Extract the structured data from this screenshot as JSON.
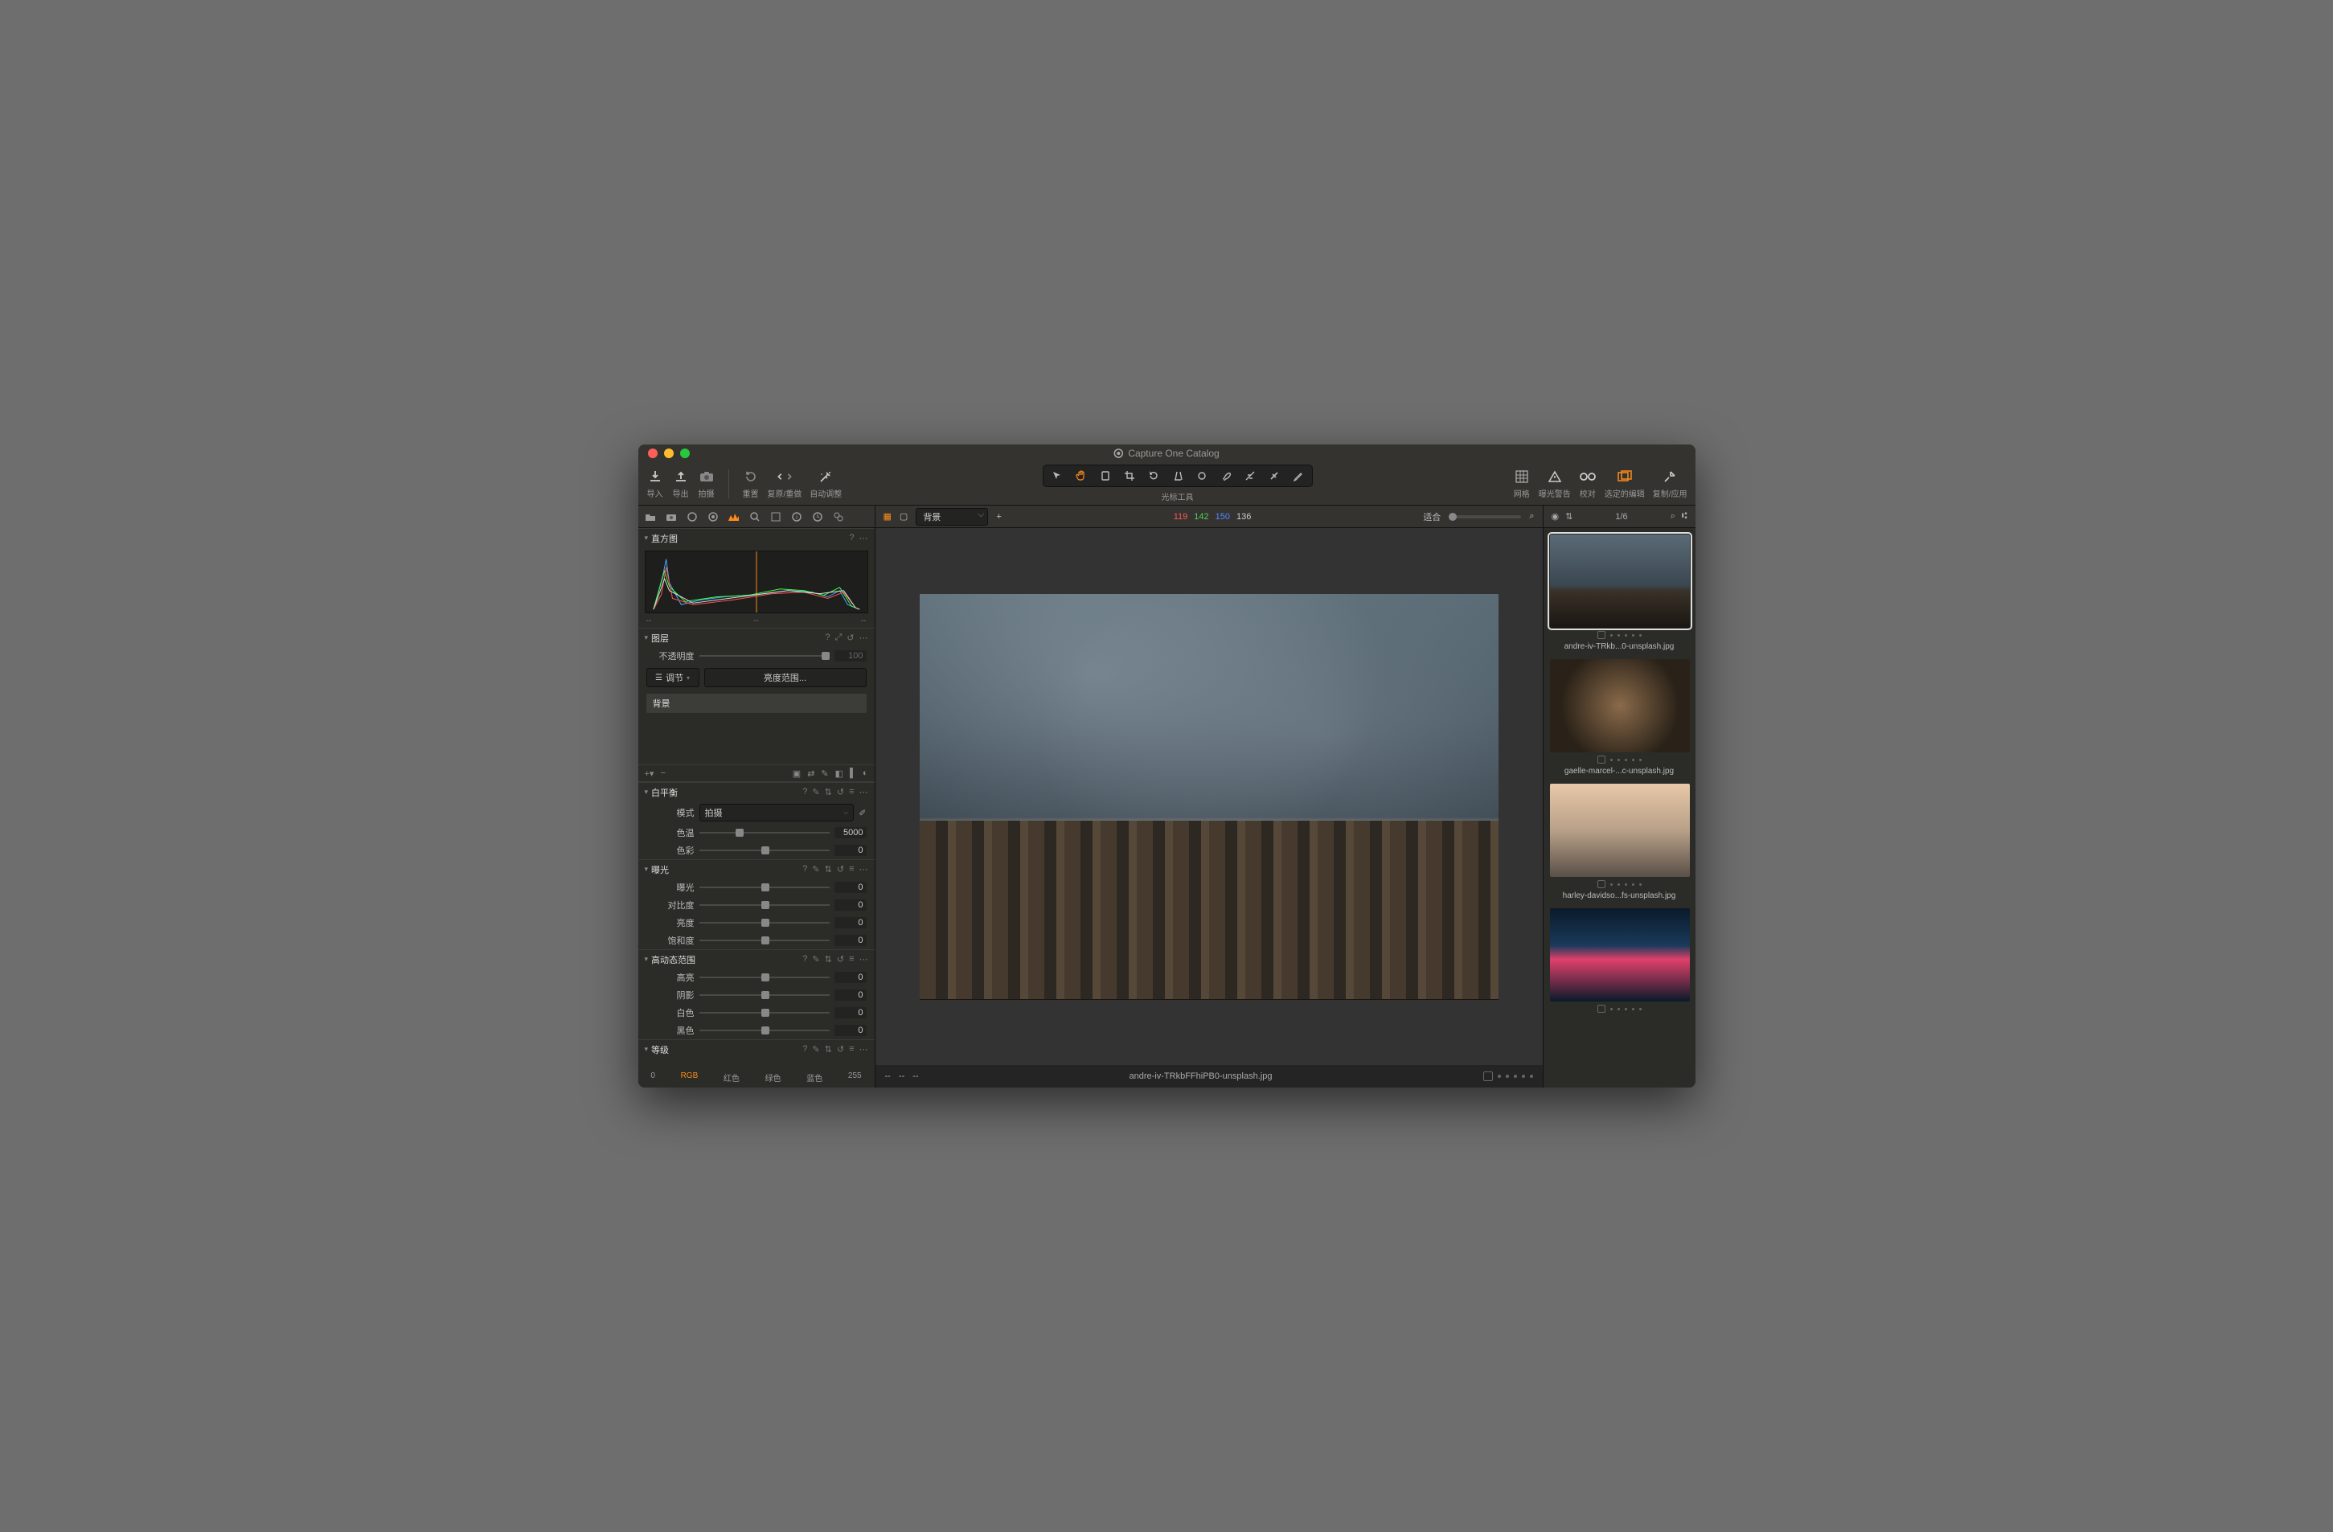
{
  "window": {
    "title": "Capture One Catalog"
  },
  "toolbar": {
    "import": "导入",
    "export": "导出",
    "capture": "拍摄",
    "reset": "重置",
    "undoredo": "复原/重做",
    "autoadjust": "自动调整",
    "cursor_label": "光标工具",
    "grid": "网格",
    "expowarn": "曝光警告",
    "proof": "校对",
    "selected_edit": "选定的编辑",
    "copyapply": "复制/应用"
  },
  "viewertop": {
    "layer_sel": "背景",
    "readout": {
      "r": "119",
      "g": "142",
      "b": "150",
      "l": "136"
    },
    "fit": "适合"
  },
  "viewer": {
    "filename": "andre-iv-TRkbFFhiPB0-unsplash.jpg"
  },
  "browser": {
    "counter": "1/6"
  },
  "thumbs": [
    {
      "name": "andre-iv-TRkb...0-unsplash.jpg",
      "selected": true,
      "bg": "linear-gradient(180deg,#5a6b76,#3a4650 55%,#3a3228 60%,#1a1612)"
    },
    {
      "name": "gaelle-marcel-...c-unsplash.jpg",
      "selected": false,
      "bg": "radial-gradient(circle at 50% 50%,#8a6a4a,#2a2218 70%)"
    },
    {
      "name": "harley-davidso...fs-unsplash.jpg",
      "selected": false,
      "bg": "linear-gradient(180deg,#e8c8a8,#b8a088 50%,#5a5048)"
    },
    {
      "name": "",
      "selected": false,
      "bg": "linear-gradient(180deg,#0a1a2a,#1a3a5a 40%,#e0406a 55%,#0a1a2a)"
    }
  ],
  "sections": {
    "histogram": {
      "title": "直方图"
    },
    "layers": {
      "title": "图层",
      "opacity_lbl": "不透明度",
      "opacity_val": "100",
      "adjust_btn": "调节",
      "lumrange_btn": "亮度范围...",
      "items": [
        "背景"
      ]
    },
    "wb": {
      "title": "白平衡",
      "mode_lbl": "模式",
      "mode_val": "拍摄",
      "temp_lbl": "色温",
      "temp_val": "5000",
      "tint_lbl": "色彩",
      "tint_val": "0"
    },
    "exposure": {
      "title": "曝光",
      "exposure_lbl": "曝光",
      "exposure_val": "0",
      "contrast_lbl": "对比度",
      "contrast_val": "0",
      "brightness_lbl": "亮度",
      "brightness_val": "0",
      "saturation_lbl": "饱和度",
      "saturation_val": "0"
    },
    "hdr": {
      "title": "高动态范围",
      "highlight_lbl": "高亮",
      "highlight_val": "0",
      "shadow_lbl": "阴影",
      "shadow_val": "0",
      "white_lbl": "白色",
      "white_val": "0",
      "black_lbl": "黑色",
      "black_val": "0"
    },
    "levels": {
      "title": "等级",
      "ch0": "0",
      "rgb": "RGB",
      "red": "红色",
      "green": "绿色",
      "blue": "蓝色",
      "ch255": "255"
    }
  }
}
